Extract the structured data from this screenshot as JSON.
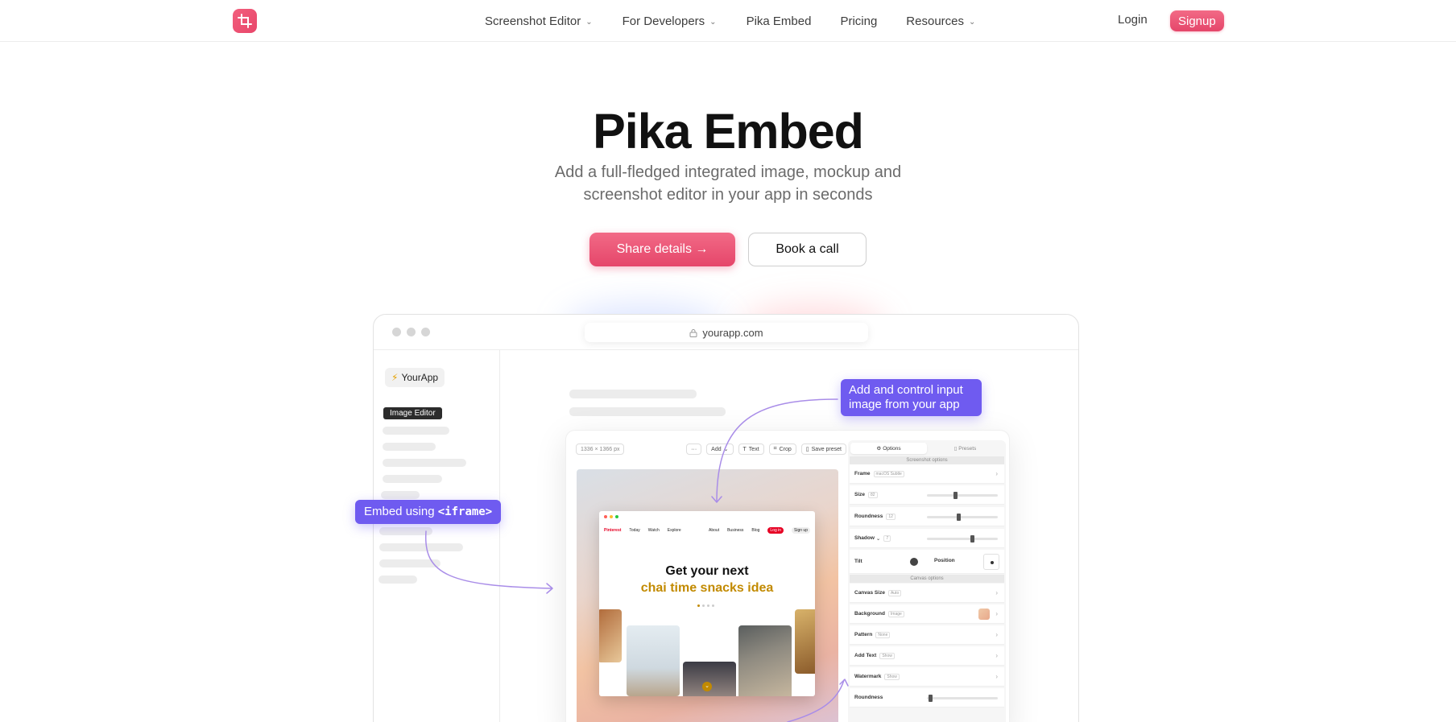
{
  "nav": {
    "links": [
      {
        "label": "Screenshot Editor",
        "dropdown": true
      },
      {
        "label": "For Developers",
        "dropdown": true
      },
      {
        "label": "Pika Embed",
        "dropdown": false
      },
      {
        "label": "Pricing",
        "dropdown": false
      },
      {
        "label": "Resources",
        "dropdown": true
      }
    ],
    "login": "Login",
    "signup": "Signup"
  },
  "hero": {
    "title": "Pika Embed",
    "subtitle": "Add a full-fledged integrated image, mockup and screenshot editor in your app in seconds",
    "primary_cta": "Share details →",
    "secondary_cta": "Book a call"
  },
  "mock": {
    "url": "yourapp.com",
    "app_name": "YourApp",
    "app_icon": "⚡",
    "active_nav": "Image Editor",
    "toolbar": {
      "dimensions": "1336 × 1366 px",
      "more": "···",
      "add": "Add",
      "text": "Text",
      "crop": "Crop",
      "save_preset": "Save preset"
    },
    "pin": {
      "brand": "Pinterest",
      "nav_left": [
        "Today",
        "Watch",
        "Explore"
      ],
      "nav_right": [
        "About",
        "Business",
        "Blog"
      ],
      "login": "Log in",
      "signup": "Sign up",
      "headline_1": "Get your next",
      "headline_2": "chai time snacks idea"
    },
    "options": {
      "tab_options": "Options",
      "tab_presets": "Presets",
      "section_screenshot": "Screenshot options",
      "section_canvas": "Canvas options",
      "frame": {
        "label": "Frame",
        "tag": "macOS Subtle"
      },
      "size": {
        "label": "Size",
        "tag": "82",
        "value": 0.4
      },
      "roundness": {
        "label": "Roundness",
        "tag": "12",
        "value": 0.45
      },
      "shadow": {
        "label": "Shadow",
        "tag": "7",
        "value": 0.65
      },
      "tilt": "Tilt",
      "position": "Position",
      "canvas_size": {
        "label": "Canvas Size",
        "tag": "Auto"
      },
      "background": {
        "label": "Background",
        "tag": "Image"
      },
      "pattern": {
        "label": "Pattern",
        "tag": "None"
      },
      "add_text": {
        "label": "Add Text",
        "tag": "Show"
      },
      "watermark": {
        "label": "Watermark",
        "tag": "Show"
      },
      "roundness2": {
        "label": "Roundness",
        "value": 0.02
      }
    }
  },
  "callouts": {
    "input": "Add and control input image from your app",
    "embed_prefix": "Embed using ",
    "embed_code": "<iframe>"
  },
  "colors": {
    "brand": "#e8466a",
    "callout": "#6f5bf0",
    "pin_accent": "#c28a00"
  }
}
